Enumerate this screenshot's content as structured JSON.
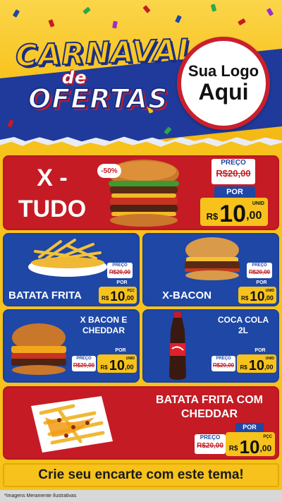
{
  "header": {
    "title_line1": "CARNAVAL",
    "title_de": "de",
    "title_line3": "OFERTAS",
    "logo_line1": "Sua Logo",
    "logo_line2": "Aqui"
  },
  "colors": {
    "yellow": "#f6c21b",
    "red": "#c51b25",
    "blue": "#1e47a6",
    "navy": "#1a2e86"
  },
  "products": {
    "xtudo": {
      "name_l1": "X -",
      "name_l2": "TUDO",
      "badge": "-50%",
      "preco_label": "PREÇO",
      "old_price": "R$20,00",
      "por_label": "POR",
      "currency": "R$",
      "price_int": "10",
      "price_dec": ",00",
      "unit": "UNID"
    },
    "batata": {
      "name": "BATATA FRITA",
      "preco_label": "PREÇO",
      "old_price": "R$20,00",
      "por_label": "POR",
      "currency": "R$",
      "price_int": "10",
      "price_dec": ",00",
      "unit": "PÇC"
    },
    "xbacon": {
      "name": "X-BACON",
      "preco_label": "PREÇO",
      "old_price": "R$20,00",
      "por_label": "POR",
      "currency": "R$",
      "price_int": "10",
      "price_dec": ",00",
      "unit": "UNID"
    },
    "xbaconcheddar": {
      "name_l1": "X BACON E",
      "name_l2": "CHEDDAR",
      "preco_label": "PREÇO",
      "old_price": "R$20,00",
      "por_label": "POR",
      "currency": "R$",
      "price_int": "10",
      "price_dec": ",00",
      "unit": "UNID"
    },
    "coca": {
      "name_l1": "COCA COLA",
      "name_l2": "2L",
      "preco_label": "PREÇO",
      "old_price": "R$20,00",
      "por_label": "POR",
      "currency": "R$",
      "price_int": "10",
      "price_dec": ",00",
      "unit": "UNID"
    },
    "batatacheddar": {
      "name_l1": "BATATA FRITA COM",
      "name_l2": "CHEDDAR",
      "preco_label": "PREÇO",
      "old_price": "R$20,00",
      "por_label": "POR",
      "currency": "R$",
      "price_int": "10",
      "price_dec": ",00",
      "unit": "PÇC"
    }
  },
  "footer": {
    "cta": "Crie seu encarte com este tema!",
    "disclaimer": "*Imagens Meramente Ilustrativas"
  }
}
